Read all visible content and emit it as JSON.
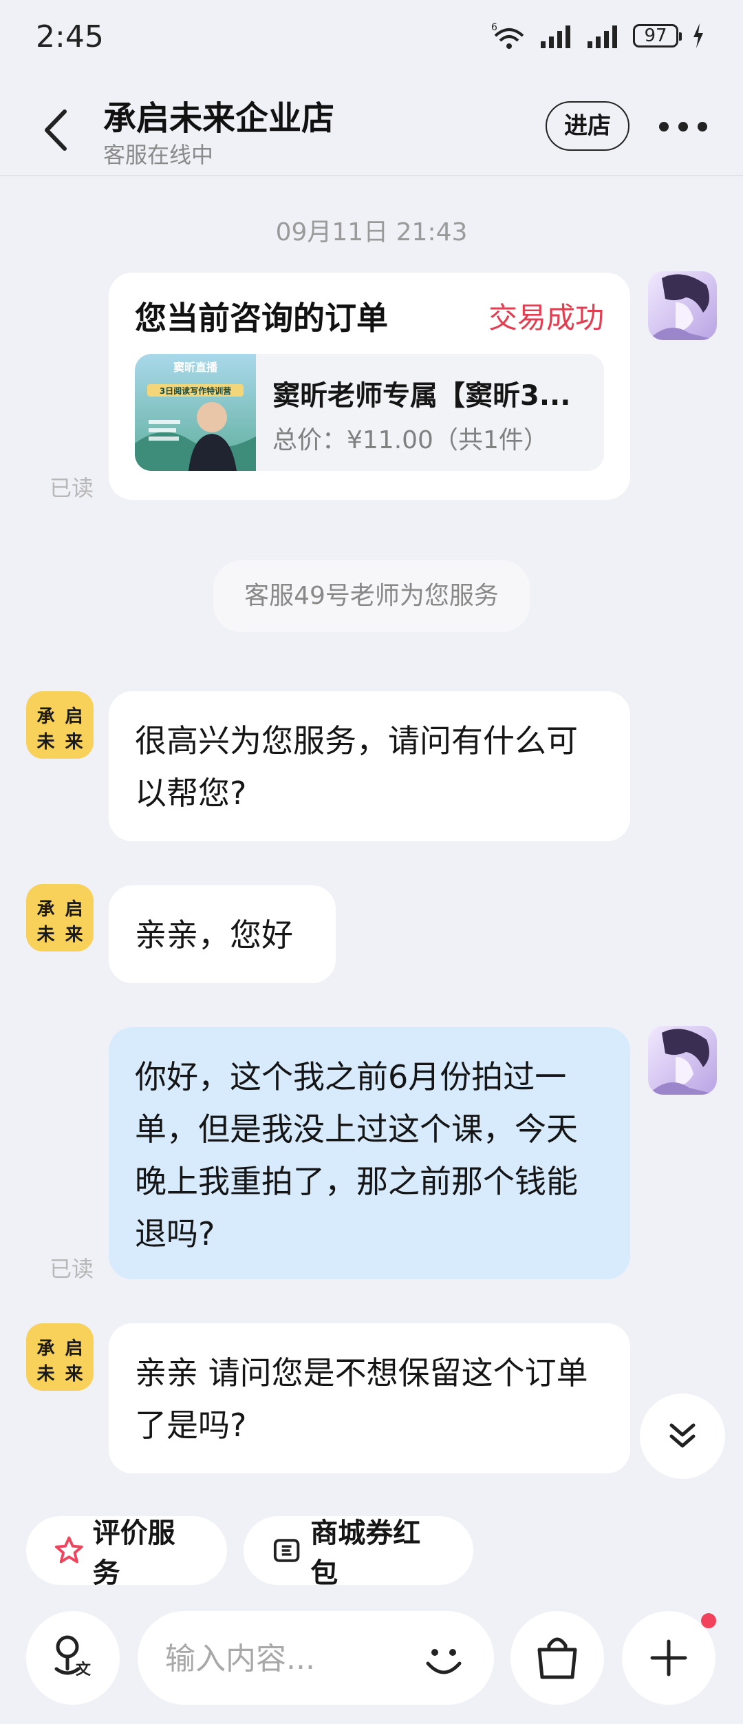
{
  "status_bar": {
    "time": "2:45",
    "network_badge": "6",
    "battery": "97"
  },
  "header": {
    "shop_name": "承启未来企业店",
    "status": "客服在线中",
    "enter_store_label": "进店"
  },
  "chat": {
    "timestamp": "09月11日 21:43",
    "order_card": {
      "title": "您当前咨询的订单",
      "status": "交易成功",
      "status_color": "#e33d51",
      "product_name": "窦昕老师专属【窦昕3...",
      "price_line": "总价：¥11.00（共1件）",
      "thumb_title": "窦昕直播",
      "thumb_subtitle": "3日阅读写作特训营"
    },
    "read_label": "已读",
    "system_notice": "客服49号老师为您服务",
    "shop_avatar_chars": [
      "承",
      "启",
      "未",
      "来"
    ],
    "messages": [
      {
        "from": "shop",
        "text": "很高兴为您服务，请问有什么可以帮您?"
      },
      {
        "from": "shop",
        "text": "亲亲，您好"
      },
      {
        "from": "me",
        "text": "你好，这个我之前6月份拍过一单，但是我没上过这个课，今天晚上我重拍了，那之前那个钱能退吗?"
      },
      {
        "from": "shop",
        "text": "亲亲 请问您是不想保留这个订单了是吗?"
      }
    ]
  },
  "quick_actions": {
    "rate_service": "评价服务",
    "coupons": "商城券红包"
  },
  "input_bar": {
    "placeholder": "输入内容..."
  },
  "colors": {
    "accent_red": "#e33d51",
    "my_bubble": "#d7ebfd",
    "shop_avatar": "#f7d15a"
  }
}
